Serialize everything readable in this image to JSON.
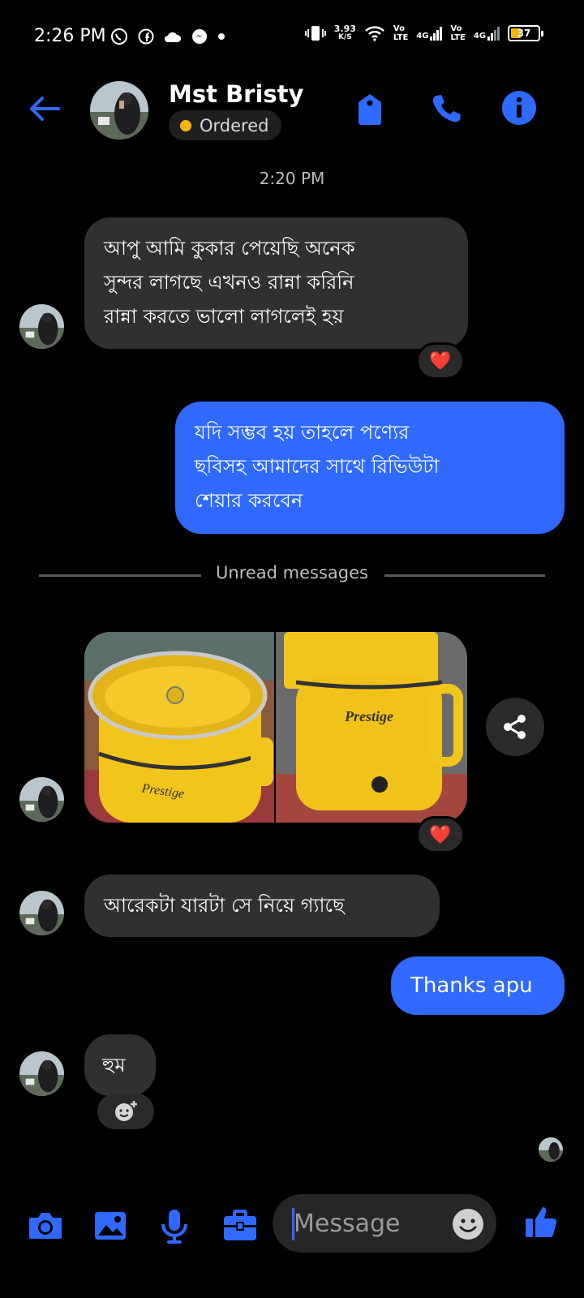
{
  "status_bar": {
    "time": "2:26 PM",
    "net_speed_value": "3.93",
    "net_speed_unit": "K/S",
    "sim1_tech": "Vo\nLTE",
    "sim1_gen": "4G",
    "sim2_tech": "Vo\nLTE",
    "sim2_gen": "4G",
    "battery": "37",
    "icons": [
      "whatsapp-icon",
      "facebook-icon",
      "cloud-icon",
      "messenger-icon",
      "dot-icon",
      "vibrate-icon",
      "wifi-icon",
      "signal-icon",
      "battery-icon"
    ]
  },
  "header": {
    "contact_name": "Mst Bristy",
    "status_label": "Ordered",
    "status_color": "#f6b60b",
    "accent": "#2f69ff"
  },
  "conversation": {
    "timestamp": "2:20 PM",
    "messages": [
      {
        "direction": "in",
        "lines": [
          "আপু আমি কুকার পেয়েছি অনেক",
          "সুন্দর লাগছে এখনও রান্না করিনি",
          "রান্না করতে ভালো লাগলেই হয়"
        ],
        "reaction": "❤️"
      },
      {
        "direction": "out",
        "lines": [
          "যদি সম্ভব হয় তাহলে পণ্যের",
          "ছবিসহ আমাদের সাথে রিভিউটা",
          "শেয়ার করবেন"
        ]
      },
      {
        "direction": "in",
        "type": "photos",
        "reaction": "❤️"
      },
      {
        "direction": "in",
        "lines": [
          "আরেকটা যারটা সে নিয়ে গ্যাছে"
        ]
      },
      {
        "direction": "out",
        "lines": [
          "Thanks apu"
        ]
      },
      {
        "direction": "in",
        "lines": [
          "হুম"
        ]
      }
    ],
    "unread_divider": "Unread messages",
    "photo_brand_text": "Prestige"
  },
  "composer": {
    "placeholder": "Message"
  }
}
